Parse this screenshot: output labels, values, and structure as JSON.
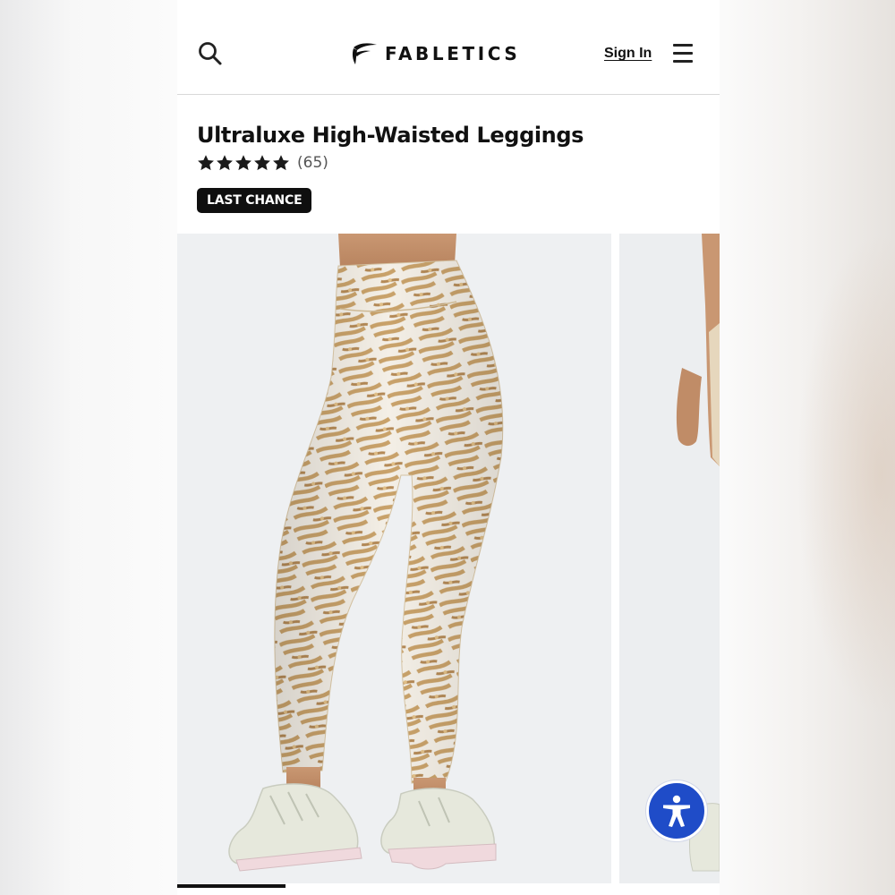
{
  "header": {
    "brand": "FABLETICS",
    "sign_in_label": "Sign In",
    "icons": {
      "search": "search-icon",
      "menu": "hamburger-menu-icon",
      "logo": "fabletics-logo-icon"
    }
  },
  "product": {
    "title": "Ultraluxe High-Waisted Leggings",
    "rating": {
      "stars": 5,
      "max_stars": 5,
      "review_count": "(65)"
    },
    "badge": "LAST CHANCE"
  },
  "gallery": {
    "current_slide": 1,
    "progress": 0.2,
    "images": [
      "leggings-back-view-photo",
      "leggings-side-view-photo"
    ]
  },
  "accessibility_button": {
    "icon": "accessibility-person-icon",
    "color": "#1f4cc8"
  },
  "colors": {
    "text": "#111111",
    "badge_bg": "#0f0f0f",
    "divider": "#d9d9d9",
    "accent": "#1f4cc8"
  }
}
